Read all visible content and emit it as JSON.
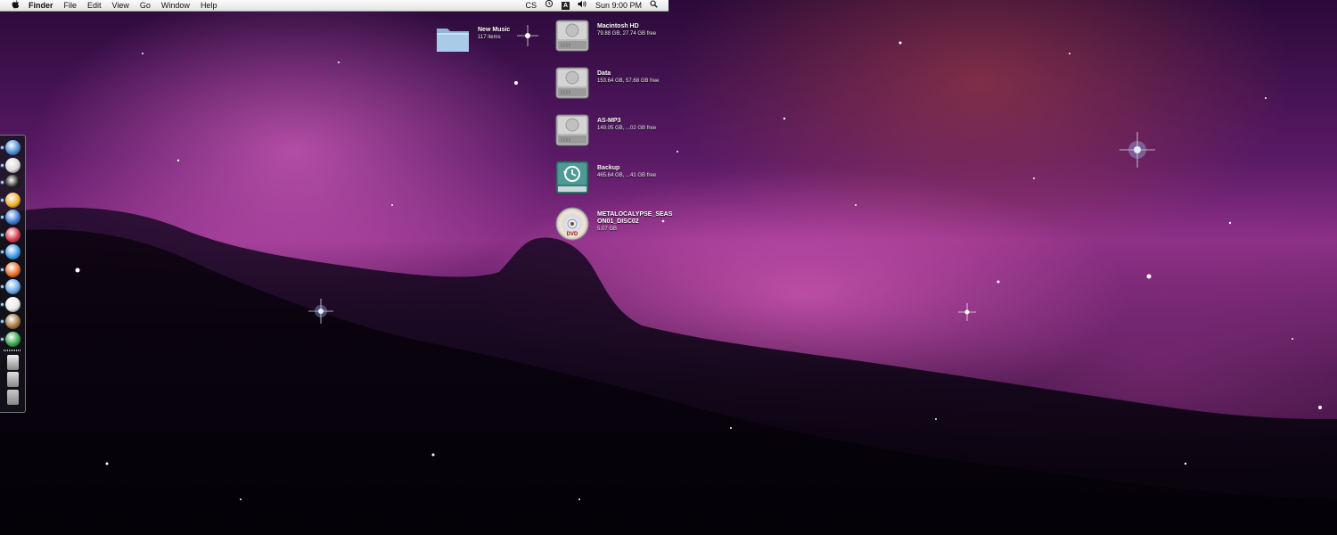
{
  "menubar": {
    "apple_glyph": "",
    "app_name": "Finder",
    "menus": [
      "File",
      "Edit",
      "View",
      "Go",
      "Window",
      "Help"
    ],
    "extras": {
      "cs_label": "CS",
      "input_label": "A",
      "clock": "Sun 9:00 PM"
    }
  },
  "desktop": {
    "icons": [
      {
        "name": "New Music",
        "info": "117 items",
        "type": "folder"
      },
      {
        "name": "Macintosh HD",
        "info": "79.88 GB, 27.74 GB free",
        "type": "hard-drive"
      },
      {
        "name": "Data",
        "info": "153.64 GB, 57.68 GB free",
        "type": "hard-drive"
      },
      {
        "name": "AS-MP3",
        "info": "149.05 GB, ...02 GB free",
        "type": "hard-drive"
      },
      {
        "name": "Backup",
        "info": "465.64 GB, ...41 GB free",
        "type": "time-machine-drive"
      },
      {
        "name": "METALOCALYPSE_SEAS\nON01_DISC02",
        "info": "5.07 GB",
        "type": "dvd"
      }
    ]
  },
  "dock": {
    "items": [
      {
        "icon": "finder-icon",
        "running": true,
        "color": "#4a90d9"
      },
      {
        "icon": "app-shield-icon",
        "running": true,
        "color": "#d8d8d8"
      },
      {
        "icon": "terminal-icon",
        "running": true,
        "color": "#1a1a1a"
      },
      {
        "icon": "adium-duck-icon",
        "running": true,
        "color": "#f0b030"
      },
      {
        "icon": "itunes-icon",
        "running": true,
        "color": "#3a7ad8"
      },
      {
        "icon": "lastfm-icon",
        "running": true,
        "color": "#d83a4a"
      },
      {
        "icon": "messenger-icon",
        "running": true,
        "color": "#3a9ae8"
      },
      {
        "icon": "firefox-icon",
        "running": true,
        "color": "#e8702a"
      },
      {
        "icon": "safari-icon",
        "running": true,
        "color": "#6aa8e8"
      },
      {
        "icon": "script-editor-icon",
        "running": true,
        "color": "#e8e8e8"
      },
      {
        "icon": "coffee-icon",
        "running": true,
        "color": "#a87840"
      },
      {
        "icon": "activity-monitor-icon",
        "running": true,
        "color": "#3aa84a"
      }
    ],
    "stack_items": [
      {
        "icon": "documents-stack-icon",
        "color": "#f0f0f0"
      },
      {
        "icon": "downloads-stack-icon",
        "color": "#e0e0e0"
      },
      {
        "icon": "trash-icon",
        "color": "#c8c8c8"
      }
    ]
  }
}
